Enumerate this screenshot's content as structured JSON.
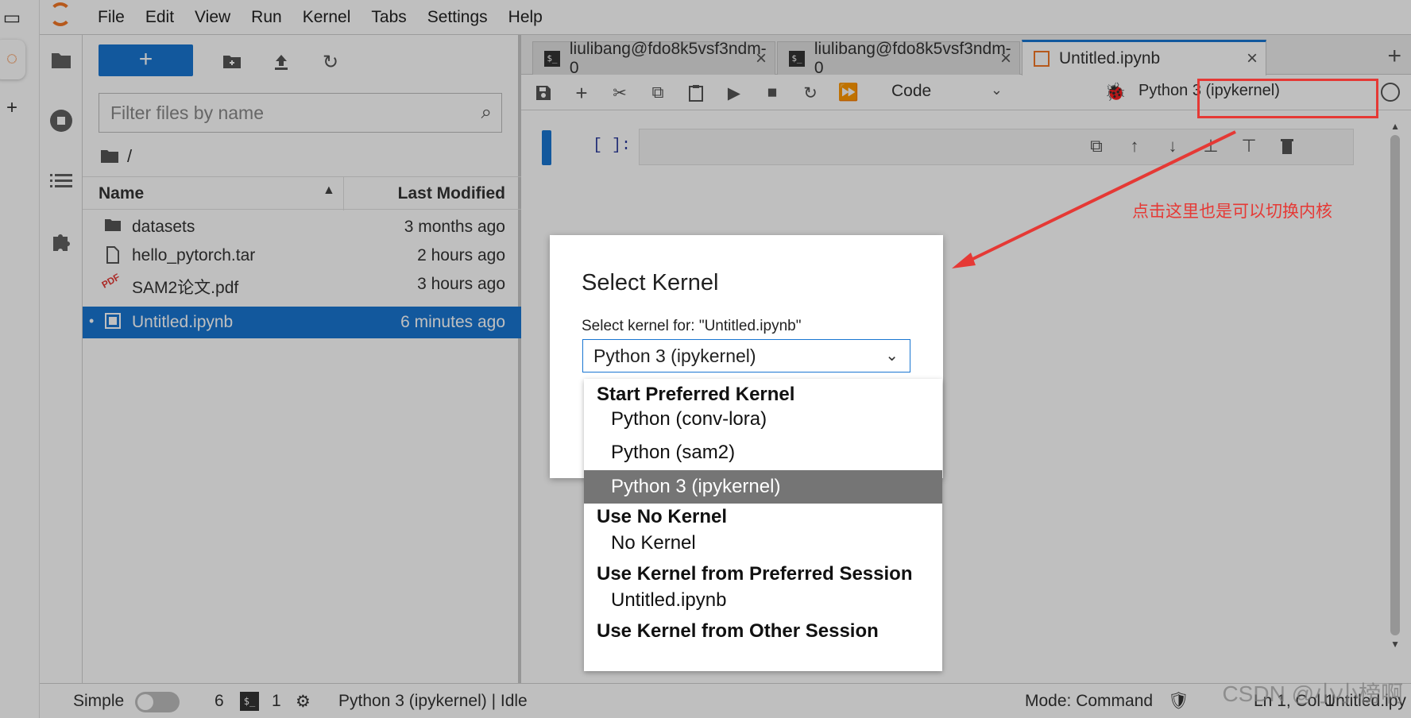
{
  "menubar": {
    "items": [
      "File",
      "Edit",
      "View",
      "Run",
      "Kernel",
      "Tabs",
      "Settings",
      "Help"
    ]
  },
  "filebrowser": {
    "new_label": "+",
    "filter_placeholder": "Filter files by name",
    "breadcrumb": "/",
    "col_name": "Name",
    "col_modified": "Last Modified",
    "files": [
      {
        "name": "datasets",
        "modified": "3 months ago",
        "type": "folder"
      },
      {
        "name": "hello_pytorch.tar",
        "modified": "2 hours ago",
        "type": "file"
      },
      {
        "name": "SAM2论文.pdf",
        "modified": "3 hours ago",
        "type": "pdf"
      },
      {
        "name": "Untitled.ipynb",
        "modified": "6 minutes ago",
        "type": "notebook",
        "selected": true
      }
    ]
  },
  "tabs": [
    {
      "label": "liulibang@fdo8k5vsf3ndm-0"
    },
    {
      "label": "liulibang@fdo8k5vsf3ndm-0"
    },
    {
      "label": "Untitled.ipynb",
      "active": true
    }
  ],
  "notebook": {
    "cell_type": "Code",
    "kernel_name": "Python 3 (ipykernel)",
    "prompt": "[ ]:"
  },
  "annotation": {
    "text": "点击这里也是可以切换内核",
    "color": "#e53935"
  },
  "dialog": {
    "title": "Select Kernel",
    "label": "Select kernel for: \"Untitled.ipynb\"",
    "selected": "Python 3 (ipykernel)"
  },
  "dropdown": {
    "groups": [
      {
        "title": "Start Preferred Kernel",
        "options": [
          "Python (conv-lora)",
          "Python (sam2)",
          "Python 3 (ipykernel)"
        ]
      },
      {
        "title": "Use No Kernel",
        "options": [
          "No Kernel"
        ]
      },
      {
        "title": "Use Kernel from Preferred Session",
        "options": [
          "Untitled.ipynb"
        ]
      },
      {
        "title": "Use Kernel from Other Session",
        "options": []
      }
    ],
    "highlighted": "Python 3 (ipykernel)"
  },
  "statusbar": {
    "simple_label": "Simple",
    "terminals_count": "6",
    "kernels_count": "1",
    "kernel_status": "Python 3 (ipykernel) | Idle",
    "mode": "Mode: Command",
    "position": "Ln 1, Col 1",
    "filename": "Untitled.ipy"
  },
  "watermark": "CSDN @小小榜啊",
  "colors": {
    "accent": "#1976d2",
    "jupyter_orange": "#f37726",
    "annotation_red": "#e53935"
  }
}
